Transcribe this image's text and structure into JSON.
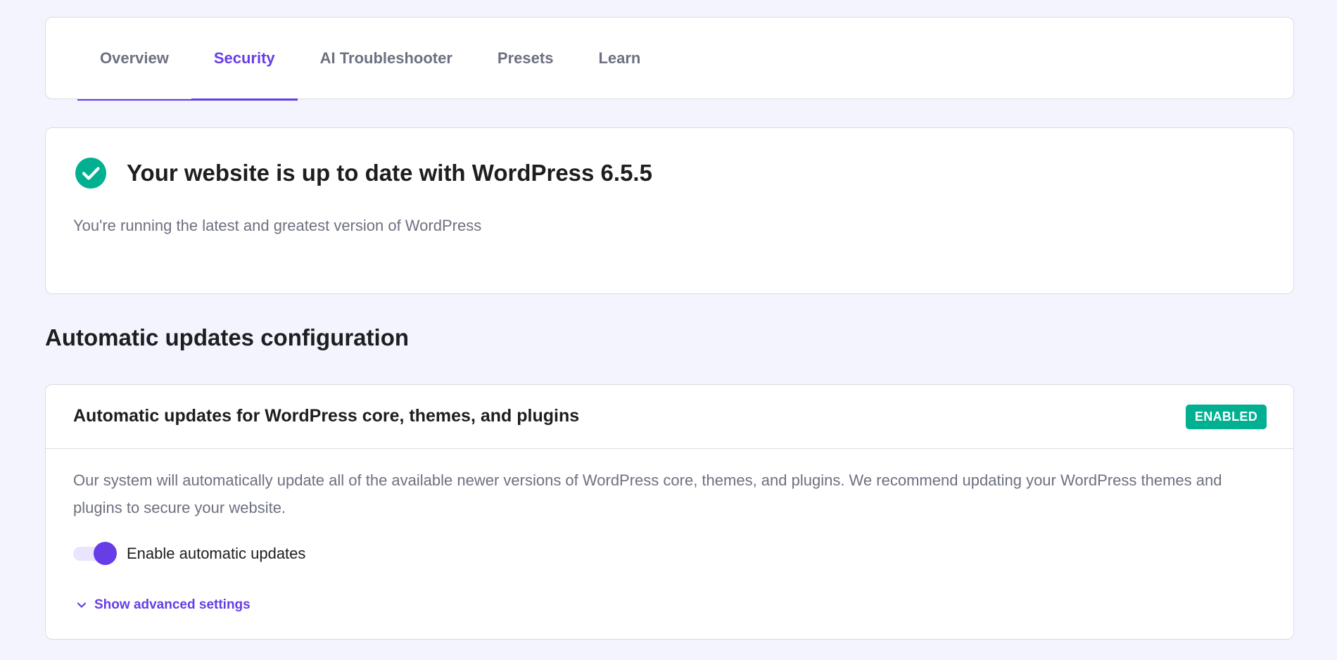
{
  "tabs": [
    {
      "label": "Overview",
      "active": false
    },
    {
      "label": "Security",
      "active": true
    },
    {
      "label": "AI Troubleshooter",
      "active": false
    },
    {
      "label": "Presets",
      "active": false
    },
    {
      "label": "Learn",
      "active": false
    }
  ],
  "status": {
    "icon": "check-circle-icon",
    "title": "Your website is up to date with WordPress 6.5.5",
    "subtitle": "You're running the latest and greatest version of WordPress"
  },
  "section": {
    "title": "Automatic updates configuration"
  },
  "auto_updates": {
    "title": "Automatic updates for WordPress core, themes, and plugins",
    "badge": "ENABLED",
    "description": "Our system will automatically update all of the available newer versions of WordPress core, themes, and plugins. We recommend updating your WordPress themes and plugins to secure your website.",
    "toggle_label": "Enable automatic updates",
    "toggle_on": true,
    "advanced_link": "Show advanced settings",
    "advanced_icon": "chevron-down-icon"
  },
  "colors": {
    "accent": "#673de6",
    "success": "#00b090",
    "page_background": "#f4f4fe",
    "muted_text": "#6d7081"
  }
}
